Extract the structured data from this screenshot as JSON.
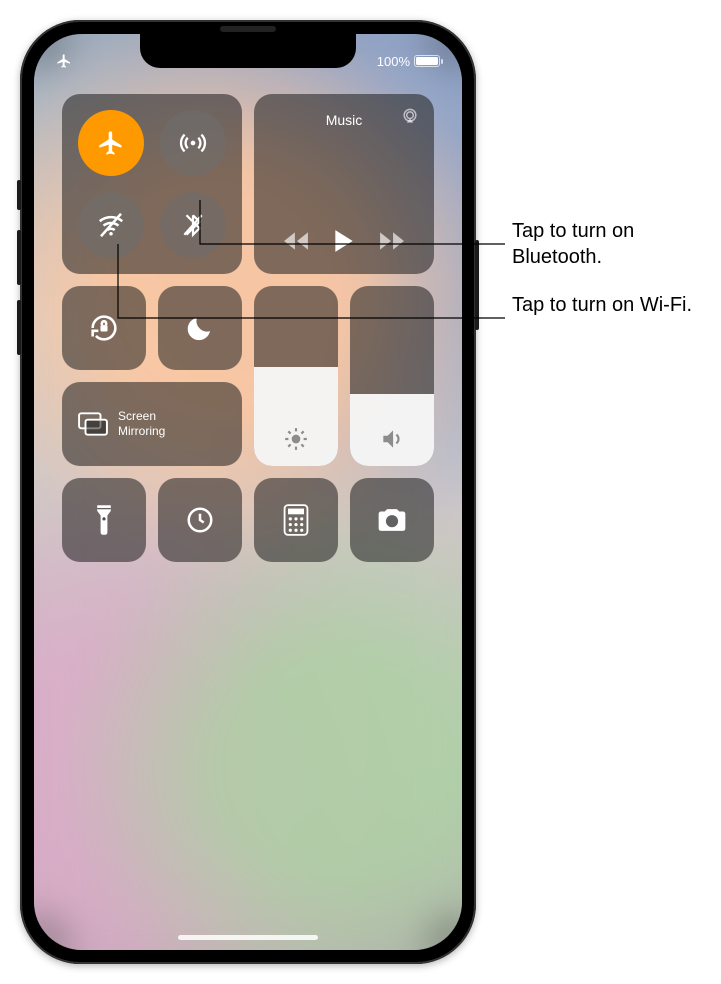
{
  "status": {
    "battery_pct": "100%",
    "battery_fill_pct": 100
  },
  "connectivity": {
    "airplane": {
      "name": "airplane-mode",
      "on": true
    },
    "cellular": {
      "name": "cellular-data",
      "on": false
    },
    "wifi": {
      "name": "wifi",
      "on": false
    },
    "bluetooth": {
      "name": "bluetooth",
      "on": false
    }
  },
  "media": {
    "title": "Music"
  },
  "mirror_label": "Screen\nMirroring",
  "sliders": {
    "brightness_pct": 55,
    "volume_pct": 40
  },
  "callouts": {
    "bluetooth": "Tap to turn on Bluetooth.",
    "wifi": "Tap to turn on Wi-Fi."
  },
  "colors": {
    "airplane_on": "#ff9900",
    "module_bg": "rgba(30,30,30,0.55)",
    "off_btn": "rgba(110,110,110,0.55)"
  }
}
